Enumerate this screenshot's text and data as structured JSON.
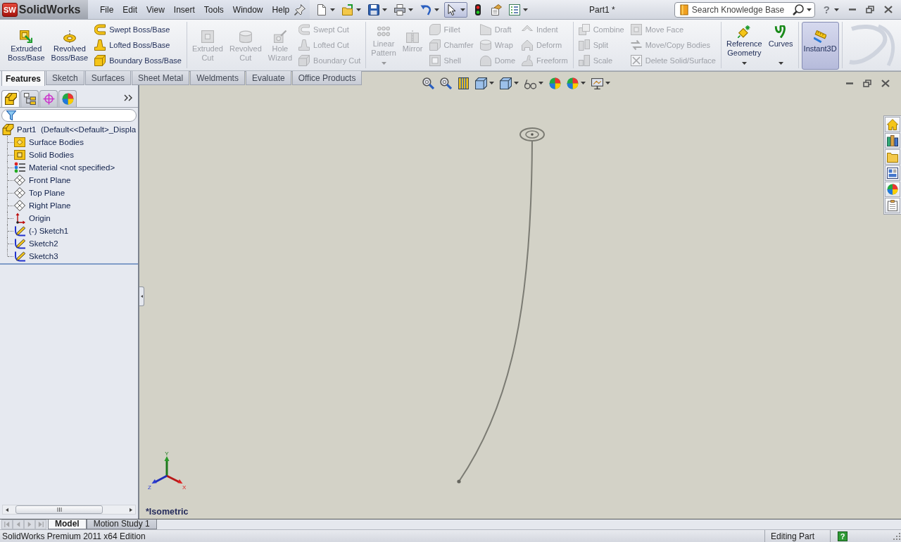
{
  "app": {
    "badge": "SW",
    "name": "SolidWorks"
  },
  "menu": [
    {
      "label": "File"
    },
    {
      "label": "Edit"
    },
    {
      "label": "View"
    },
    {
      "label": "Insert"
    },
    {
      "label": "Tools"
    },
    {
      "label": "Window"
    },
    {
      "label": "Help"
    }
  ],
  "toolbar": {
    "select": {
      "on": true
    }
  },
  "document_title": "Part1 *",
  "search": {
    "placeholder": "Search Knowledge Base"
  },
  "help": "?",
  "command_manager": {
    "groups": [
      {
        "items": [
          {
            "kind": "large",
            "label": "Extruded Boss/Base",
            "disabled": false,
            "dropdown": false,
            "on": false
          },
          {
            "kind": "large",
            "label": "Revolved Boss/Base",
            "disabled": false,
            "dropdown": false,
            "on": false
          },
          {
            "kind": "column",
            "tools": [
              {
                "label": "Swept Boss/Base",
                "disabled": false
              },
              {
                "label": "Lofted Boss/Base",
                "disabled": false
              },
              {
                "label": "Boundary Boss/Base",
                "disabled": false
              }
            ]
          }
        ]
      },
      {
        "items": [
          {
            "kind": "large",
            "label": "Extruded Cut",
            "disabled": true,
            "dropdown": false,
            "on": false
          },
          {
            "kind": "large",
            "label": "Revolved Cut",
            "disabled": true,
            "dropdown": false,
            "on": false
          },
          {
            "kind": "large",
            "label": "Hole Wizard",
            "disabled": true,
            "dropdown": false,
            "on": false
          },
          {
            "kind": "column",
            "tools": [
              {
                "label": "Swept Cut",
                "disabled": true
              },
              {
                "label": "Lofted Cut",
                "disabled": true
              },
              {
                "label": "Boundary Cut",
                "disabled": true
              }
            ]
          }
        ]
      },
      {
        "items": [
          {
            "kind": "large",
            "label": "Linear Pattern",
            "disabled": true,
            "dropdown": true,
            "on": false
          },
          {
            "kind": "large",
            "label": "Mirror",
            "disabled": true,
            "dropdown": false,
            "on": false
          },
          {
            "kind": "column",
            "tools": [
              {
                "label": "Fillet",
                "disabled": true
              },
              {
                "label": "Chamfer",
                "disabled": true
              },
              {
                "label": "Shell",
                "disabled": true
              }
            ]
          },
          {
            "kind": "column",
            "tools": [
              {
                "label": "Draft",
                "disabled": true
              },
              {
                "label": "Wrap",
                "disabled": true
              },
              {
                "label": "Dome",
                "disabled": true
              }
            ]
          },
          {
            "kind": "column",
            "tools": [
              {
                "label": "Indent",
                "disabled": true
              },
              {
                "label": "Deform",
                "disabled": true
              },
              {
                "label": "Freeform",
                "disabled": true
              }
            ]
          }
        ]
      },
      {
        "items": [
          {
            "kind": "column",
            "tools": [
              {
                "label": "Combine",
                "disabled": true
              },
              {
                "label": "Split",
                "disabled": true
              },
              {
                "label": "Scale",
                "disabled": true
              }
            ]
          },
          {
            "kind": "column",
            "tools": [
              {
                "label": "Move Face",
                "disabled": true
              },
              {
                "label": "Move/Copy Bodies",
                "disabled": true
              },
              {
                "label": "Delete Solid/Surface",
                "disabled": true
              }
            ]
          }
        ]
      },
      {
        "items": [
          {
            "kind": "large",
            "label": "Reference Geometry",
            "disabled": false,
            "dropdown": true,
            "on": false
          },
          {
            "kind": "large",
            "label": "Curves",
            "disabled": false,
            "dropdown": true,
            "on": false
          }
        ]
      },
      {
        "items": [
          {
            "kind": "large",
            "label": "Instant3D",
            "disabled": false,
            "dropdown": false,
            "on": true
          }
        ]
      }
    ]
  },
  "command_tabs": [
    {
      "label": "Features",
      "selected": true
    },
    {
      "label": "Sketch",
      "selected": false
    },
    {
      "label": "Surfaces",
      "selected": false
    },
    {
      "label": "Sheet Metal",
      "selected": false
    },
    {
      "label": "Weldments",
      "selected": false
    },
    {
      "label": "Evaluate",
      "selected": false
    },
    {
      "label": "Office Products",
      "selected": false
    }
  ],
  "feature_manager": {
    "tabs": [
      {
        "selected": true
      },
      {
        "selected": false
      },
      {
        "selected": false
      },
      {
        "selected": false
      }
    ],
    "tree": [
      {
        "kind": "part",
        "label": "Part1  (Default<<Default>_Displa",
        "children": [
          {
            "kind": "surfaces",
            "label": "Surface Bodies"
          },
          {
            "kind": "solids",
            "label": "Solid Bodies"
          },
          {
            "kind": "material",
            "label": "Material <not specified>"
          },
          {
            "kind": "plane",
            "label": "Front Plane"
          },
          {
            "kind": "plane",
            "label": "Top Plane"
          },
          {
            "kind": "plane",
            "label": "Right Plane"
          },
          {
            "kind": "origin",
            "label": "Origin"
          },
          {
            "kind": "sketch",
            "label": "(-) Sketch1"
          },
          {
            "kind": "sketch",
            "label": "Sketch2"
          },
          {
            "kind": "sketch",
            "label": "Sketch3"
          }
        ]
      }
    ]
  },
  "viewport": {
    "triad": {
      "x": "X",
      "y": "Y",
      "z": "Z"
    },
    "view_name": "*Isometric"
  },
  "study_nav": [
    {
      "disabled": true
    },
    {
      "disabled": true
    },
    {
      "disabled": true
    },
    {
      "disabled": true
    }
  ],
  "bottom_tabs": [
    {
      "label": "Model",
      "selected": true
    },
    {
      "label": "Motion Study 1",
      "selected": false
    }
  ],
  "status_bar": {
    "product": "SolidWorks Premium 2011 x64 Edition",
    "mode": "Editing Part",
    "help": "?"
  }
}
